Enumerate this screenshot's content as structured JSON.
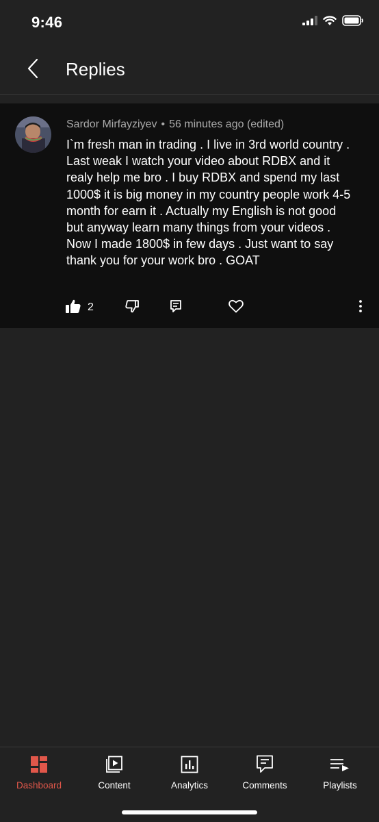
{
  "status_bar": {
    "time": "9:46"
  },
  "header": {
    "title": "Replies"
  },
  "comment": {
    "author": "Sardor Mirfayziyev",
    "separator": "•",
    "timestamp": "56 minutes ago (edited)",
    "text": "I`m fresh man in trading . I live in 3rd world country . Last weak I watch your video about RDBX and it realy help me bro . I buy RDBX and spend my last 1000$ it is big money in my country people work 4-5 month for earn it . Actually my English is not good but anyway learn many things from your videos .  Now I made 1800$ in few days . Just want to say thank you for your work bro . GOAT",
    "like_count": "2"
  },
  "bottom_nav": {
    "items": [
      {
        "label": "Dashboard",
        "icon": "dashboard-icon",
        "active": true
      },
      {
        "label": "Content",
        "icon": "content-icon",
        "active": false
      },
      {
        "label": "Analytics",
        "icon": "analytics-icon",
        "active": false
      },
      {
        "label": "Comments",
        "icon": "comments-icon",
        "active": false
      },
      {
        "label": "Playlists",
        "icon": "playlists-icon",
        "active": false
      }
    ]
  },
  "colors": {
    "background": "#222222",
    "comment_background": "#0f0f0f",
    "accent": "#e1574a",
    "meta_text": "#aaaaaa"
  }
}
